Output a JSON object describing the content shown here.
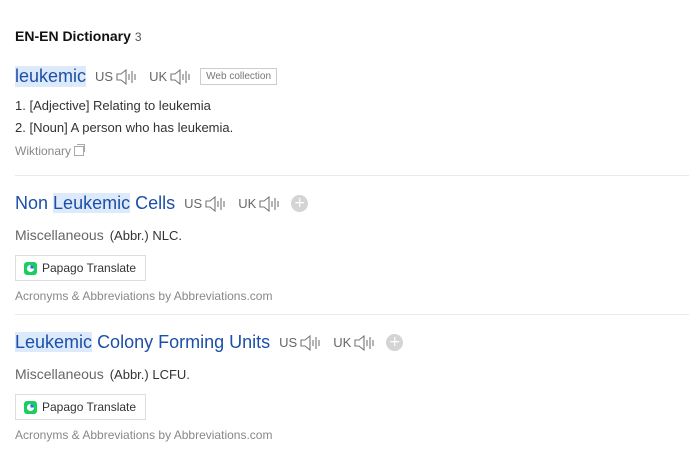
{
  "section": {
    "title": "EN-EN Dictionary",
    "count": "3"
  },
  "colors": {
    "link": "#1c4fa8",
    "highlight": "#dceafb",
    "papago_green": "#19ce60",
    "papago_blue": "#1e6fe0"
  },
  "entries": [
    {
      "word": "leukemic",
      "us_label": "US",
      "uk_label": "UK",
      "tag": "Web collection",
      "definitions": [
        "1. [Adjective] Relating to leukemia",
        "2. [Noun] A person who has leukemia."
      ],
      "source": "Wiktionary",
      "icons": [
        "speaker-icon",
        "copy-icon"
      ]
    },
    {
      "word_parts": [
        "Non",
        "Leukemic",
        "Cells"
      ],
      "us_label": "US",
      "uk_label": "UK",
      "category": "Miscellaneous",
      "abbr": "(Abbr.) NLC.",
      "translate_label": "Papago Translate",
      "source": "Acronyms & Abbreviations by Abbreviations.com",
      "icons": [
        "speaker-icon",
        "plus-icon",
        "papago-icon"
      ]
    },
    {
      "word_parts": [
        "Leukemic",
        "Colony Forming Units"
      ],
      "us_label": "US",
      "uk_label": "UK",
      "category": "Miscellaneous",
      "abbr": "(Abbr.) LCFU.",
      "translate_label": "Papago Translate",
      "source": "Acronyms & Abbreviations by Abbreviations.com",
      "icons": [
        "speaker-icon",
        "plus-icon",
        "papago-icon"
      ]
    }
  ]
}
